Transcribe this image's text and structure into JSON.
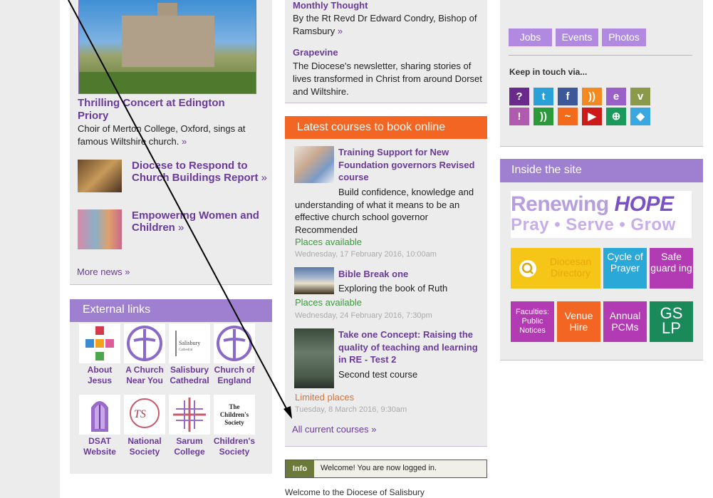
{
  "news": {
    "hero_title": "Thrilling Concert at Edington Priory",
    "hero_text": "Choir of Merton College, Oxford, sings at famous Wiltshire church.",
    "raquo": "»",
    "items": [
      {
        "title": "Diocese to Respond to Church Buildings Report"
      },
      {
        "title": "Empowering Women and Children"
      }
    ],
    "more_news": "More news"
  },
  "external_links": {
    "heading": "External links",
    "items": [
      {
        "label": "About Jesus",
        "icon": "cross-mosaic-icon"
      },
      {
        "label": "A Church Near You",
        "icon": "church-cross-circle-icon"
      },
      {
        "label": "Salisbury Cathedral",
        "icon": "salisbury-cathedral-logo",
        "logo_text": "Salisbury Cathedral"
      },
      {
        "label": "Church of England",
        "icon": "church-cross-circle-icon"
      },
      {
        "label": "DSAT Website",
        "icon": "dsat-window-icon"
      },
      {
        "label": "National Society",
        "icon": "national-society-logo"
      },
      {
        "label": "Sarum College",
        "icon": "sarum-cross-icon"
      },
      {
        "label": "Children's Society",
        "icon": "childrens-society-logo",
        "logo_text": "The Children's Society"
      }
    ]
  },
  "monthly": {
    "title": "Monthly Thought",
    "text": "By the Rt Revd Dr Edward Condry, Bishop of Ramsbury",
    "grapevine_title": "Grapevine",
    "grapevine_text": "The Diocese's newsletter, sharing stories of lives transformed in Christ from around Dorset and Wiltshire."
  },
  "courses": {
    "heading": "Latest courses to book online",
    "items": [
      {
        "title": "Training Support for New Foundation governors Revised course",
        "desc": "Build confidence, knowledge and understanding of what it means to be an effective church school governor Recommended",
        "places": "Places available",
        "date": "Wednesday, 17 February 2016, 10:00am"
      },
      {
        "title": "Bible Break one",
        "desc": "Exploring the book of Ruth",
        "places": "Places available",
        "date": "Wednesday, 24 February 2016, 7:30pm"
      },
      {
        "title": "Take one Concept: Raising the quality of teaching and learning in RE - Test 2",
        "desc": "Second test course",
        "places": "Limited places",
        "date": "Tuesday, 8 March 2016, 9:30am"
      }
    ],
    "all_courses": "All current courses"
  },
  "info_bar": {
    "tag": "Info",
    "message": "Welcome! You are now logged in."
  },
  "welcome_text": "Welcome to the Diocese of Salisbury",
  "kit": {
    "tags": [
      "Jobs",
      "Events",
      "Photos"
    ],
    "keep_in_touch": "Keep in touch via...",
    "social": [
      {
        "icon": "help-icon",
        "glyph": "?",
        "color": "#6a2a8a"
      },
      {
        "icon": "twitter-icon",
        "glyph": "t",
        "color": "#2aa0d8"
      },
      {
        "icon": "facebook-icon",
        "glyph": "f",
        "color": "#3b5998"
      },
      {
        "icon": "rss-icon",
        "glyph": "))",
        "color": "#f28a20"
      },
      {
        "icon": "email-icon",
        "glyph": "e",
        "color": "#9b5fc8"
      },
      {
        "icon": "dove-icon",
        "glyph": "v",
        "color": "#8a9a4a"
      },
      {
        "icon": "alert-quote-icon",
        "glyph": "!",
        "color": "#b05ab0"
      },
      {
        "icon": "rss-green-icon",
        "glyph": "))",
        "color": "#2a9a3a"
      },
      {
        "icon": "soundcloud-icon",
        "glyph": "~",
        "color": "#f26a1a"
      },
      {
        "icon": "youtube-icon",
        "glyph": "▶",
        "color": "#cc1a1a"
      },
      {
        "icon": "globe-icon",
        "glyph": "⊕",
        "color": "#1a9a5a"
      },
      {
        "icon": "dropbox-icon",
        "glyph": "◆",
        "color": "#3aa8e0"
      }
    ]
  },
  "inside": {
    "heading": "Inside the site",
    "renew_line1_a": "Renewing ",
    "renew_line1_b": "HOPE",
    "renew_line2": "Pray • Serve • Grow",
    "tiles": [
      {
        "label": "Diocesan Directory",
        "color": "#f5c518",
        "text_color": "#ffffff"
      },
      {
        "label": "Cycle of Prayer",
        "color": "#2aa8d8"
      },
      {
        "label": "Safe guard ing",
        "color": "#b23ab2"
      },
      {
        "label": "Faculties: Public Notices",
        "color": "#b23ab2"
      },
      {
        "label": "Venue Hire",
        "color": "#f26522"
      },
      {
        "label": "Annual PCMs",
        "color": "#b23ab2"
      },
      {
        "label": "GS LP",
        "color": "#1a8a5a"
      }
    ]
  }
}
